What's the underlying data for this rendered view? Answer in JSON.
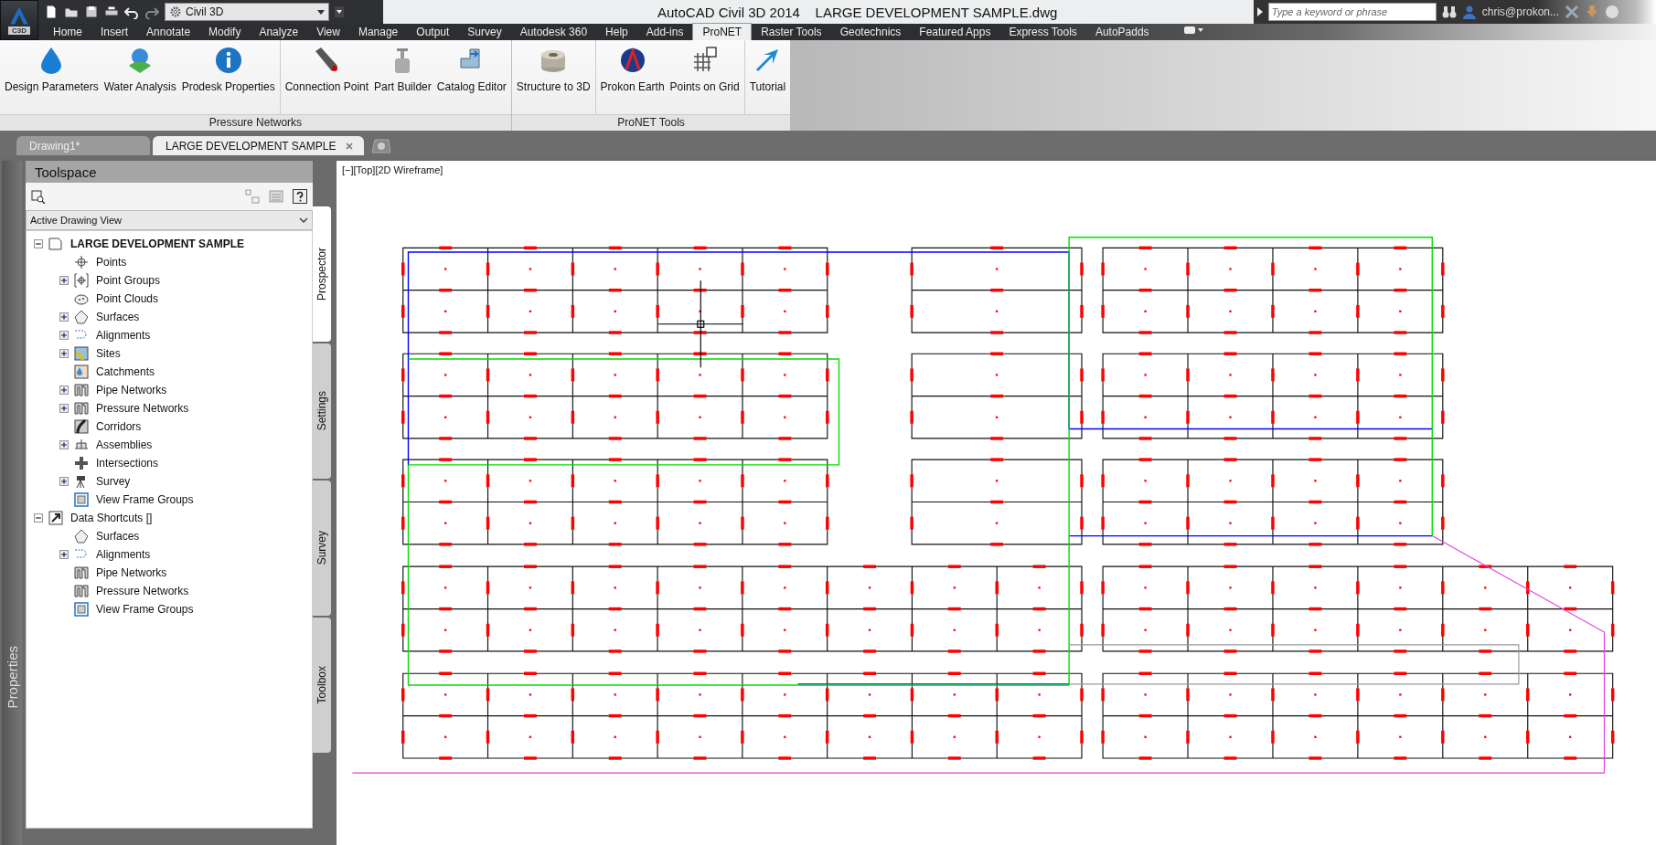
{
  "app_button": {
    "label": "C3D"
  },
  "workspace": {
    "value": "Civil 3D"
  },
  "window": {
    "title": "AutoCAD Civil 3D 2014    LARGE DEVELOPMENT SAMPLE.dwg"
  },
  "search": {
    "placeholder": "Type a keyword or phrase"
  },
  "user": {
    "name": "chris@prokon..."
  },
  "menu_tabs": [
    {
      "label": "Home",
      "selected": false
    },
    {
      "label": "Insert",
      "selected": false
    },
    {
      "label": "Annotate",
      "selected": false
    },
    {
      "label": "Modify",
      "selected": false
    },
    {
      "label": "Analyze",
      "selected": false
    },
    {
      "label": "View",
      "selected": false
    },
    {
      "label": "Manage",
      "selected": false
    },
    {
      "label": "Output",
      "selected": false
    },
    {
      "label": "Survey",
      "selected": false
    },
    {
      "label": "Autodesk 360",
      "selected": false
    },
    {
      "label": "Help",
      "selected": false
    },
    {
      "label": "Add-ins",
      "selected": false
    },
    {
      "label": "ProNET",
      "selected": true
    },
    {
      "label": "Raster Tools",
      "selected": false
    },
    {
      "label": "Geotechnics",
      "selected": false
    },
    {
      "label": "Featured Apps",
      "selected": false
    },
    {
      "label": "Express Tools",
      "selected": false
    },
    {
      "label": "AutoPadds",
      "selected": false
    }
  ],
  "ribbon_panels": [
    {
      "title": "Pressure Networks",
      "groups": [
        [
          {
            "label": "Design Parameters",
            "kind": "drop"
          },
          {
            "label": "Water Analysis",
            "kind": "globe"
          },
          {
            "label": "Prodesk Properties",
            "kind": "info"
          }
        ],
        [
          {
            "label": "Connection Point",
            "kind": "pipe"
          },
          {
            "label": "Part Builder",
            "kind": "valve"
          },
          {
            "label": "Catalog Editor",
            "kind": "fitting"
          }
        ]
      ]
    },
    {
      "title": "ProNET Tools",
      "groups": [
        [
          {
            "label": "Structure to 3D",
            "kind": "cylinder"
          }
        ],
        [
          {
            "label": "Prokon Earth",
            "kind": "earth"
          },
          {
            "label": "Points on Grid",
            "kind": "grid"
          }
        ],
        [
          {
            "label": "Tutorial",
            "kind": "arrow"
          }
        ]
      ]
    }
  ],
  "doc_tabs": [
    {
      "label": "Drawing1*",
      "selected": false
    },
    {
      "label": "LARGE DEVELOPMENT SAMPLE",
      "selected": true
    }
  ],
  "properties_palette": {
    "label": "Properties"
  },
  "toolspace": {
    "title": "Toolspace",
    "view": "Active Drawing View",
    "tree": [
      {
        "label": "LARGE DEVELOPMENT SAMPLE",
        "kind": "document",
        "expanded": true,
        "children": [
          {
            "label": "Points",
            "kind": "point"
          },
          {
            "label": "Point Groups",
            "kind": "pointgroup",
            "expanded": false
          },
          {
            "label": "Point Clouds",
            "kind": "cloud"
          },
          {
            "label": "Surfaces",
            "kind": "surface",
            "expanded": false
          },
          {
            "label": "Alignments",
            "kind": "alignment",
            "expanded": false
          },
          {
            "label": "Sites",
            "kind": "site",
            "expanded": false
          },
          {
            "label": "Catchments",
            "kind": "catchment"
          },
          {
            "label": "Pipe Networks",
            "kind": "pipe",
            "expanded": false
          },
          {
            "label": "Pressure Networks",
            "kind": "pipe",
            "expanded": false
          },
          {
            "label": "Corridors",
            "kind": "corridor"
          },
          {
            "label": "Assemblies",
            "kind": "assembly",
            "expanded": false
          },
          {
            "label": "Intersections",
            "kind": "intersection"
          },
          {
            "label": "Survey",
            "kind": "survey",
            "expanded": false
          },
          {
            "label": "View Frame Groups",
            "kind": "viewframe"
          }
        ]
      },
      {
        "label": "Data Shortcuts []",
        "kind": "shortcut",
        "expanded": true,
        "children": [
          {
            "label": "Surfaces",
            "kind": "surface"
          },
          {
            "label": "Alignments",
            "kind": "alignment",
            "expanded": false
          },
          {
            "label": "Pipe Networks",
            "kind": "pipe"
          },
          {
            "label": "Pressure Networks",
            "kind": "pipe"
          },
          {
            "label": "View Frame Groups",
            "kind": "viewframe"
          }
        ]
      }
    ],
    "side_tabs": [
      {
        "label": "Prospector",
        "selected": true
      },
      {
        "label": "Settings",
        "selected": false
      },
      {
        "label": "Survey",
        "selected": false
      },
      {
        "label": "Toolbox",
        "selected": false
      }
    ]
  },
  "viewport": {
    "label": "[−][Top][2D Wireframe]"
  }
}
